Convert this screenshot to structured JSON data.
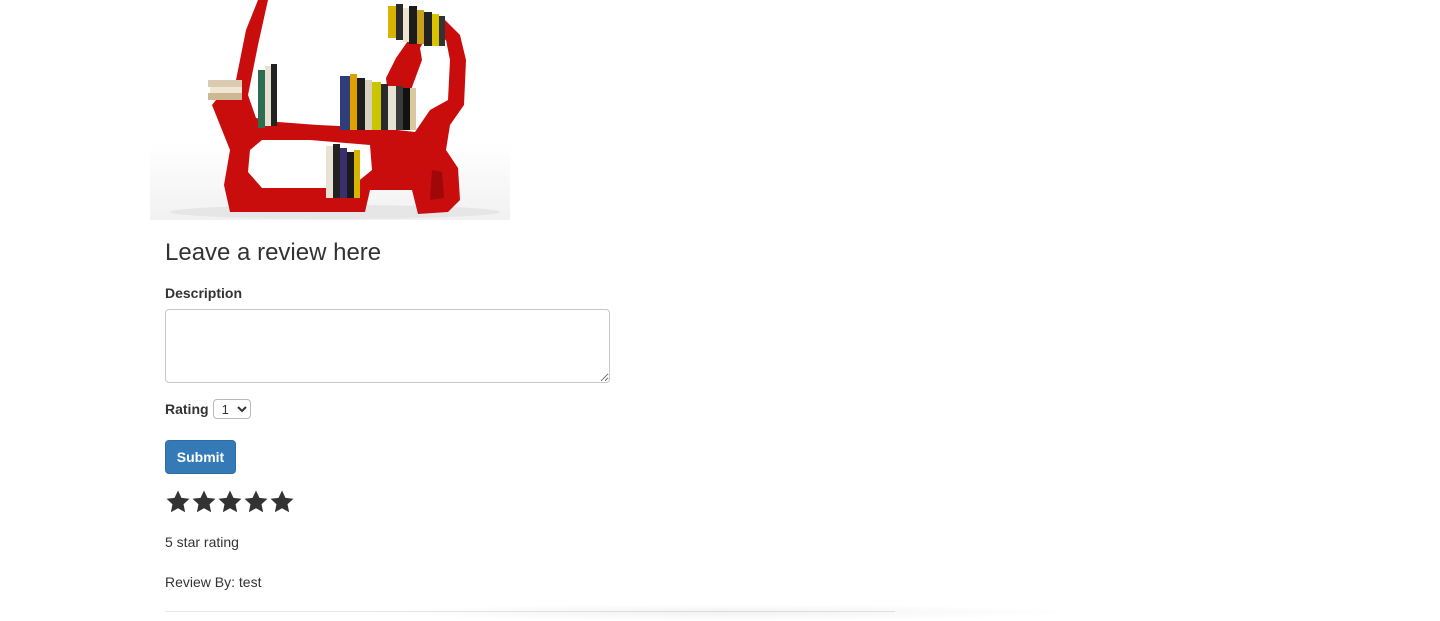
{
  "product": {
    "image_alt": "Red bookshelf shaped like a rabbit holding books"
  },
  "review_form": {
    "heading": "Leave a review here",
    "description_label": "Description",
    "description_value": "",
    "rating_label": "Rating",
    "rating_selected": "1",
    "submit_label": "Submit"
  },
  "reviews": [
    {
      "stars_filled": 5,
      "stars_total": 5,
      "rating_text": "5 star rating",
      "author_text": "Review By: test"
    }
  ],
  "colors": {
    "accent": "#337ab7",
    "text": "#333333",
    "star": "#333333",
    "shelf_red": "#c00000"
  }
}
